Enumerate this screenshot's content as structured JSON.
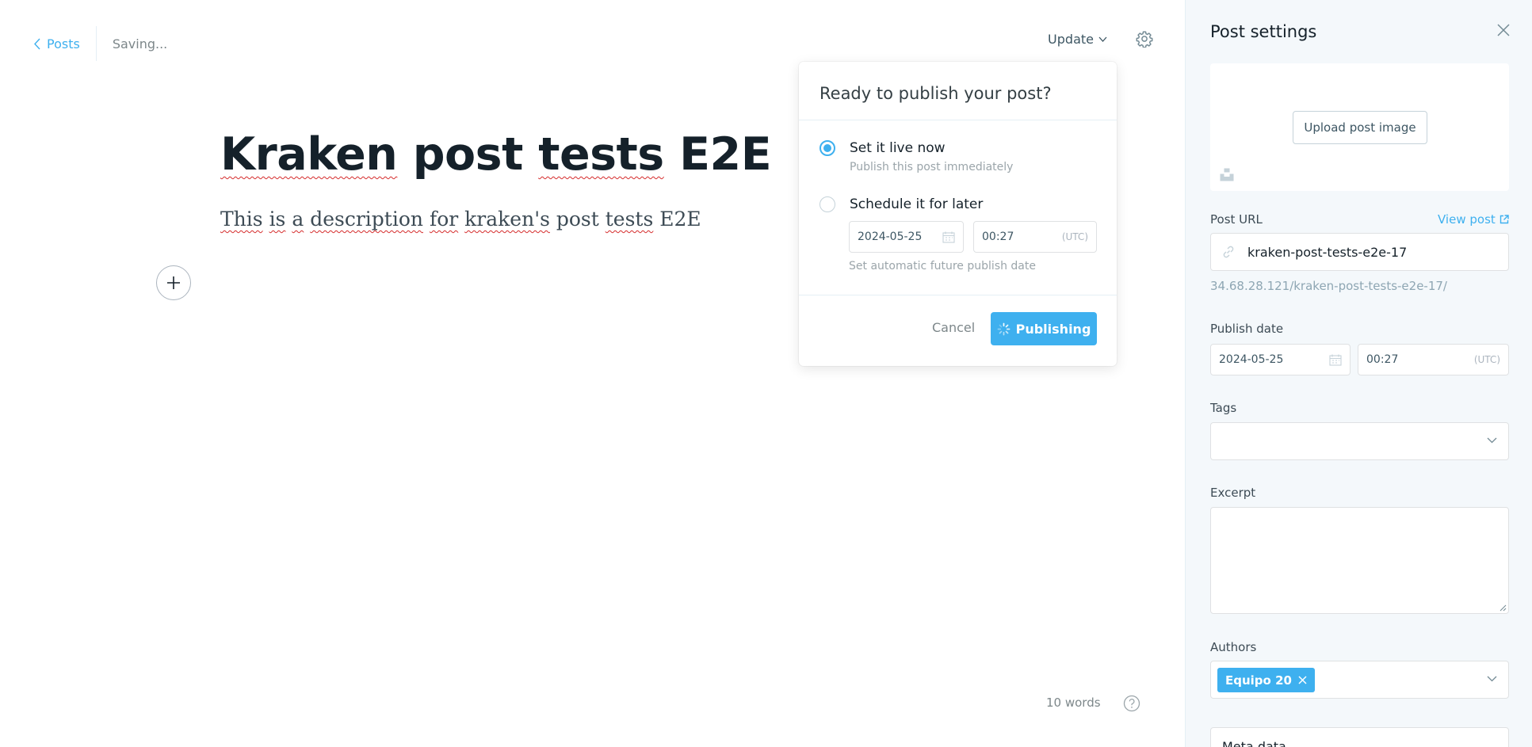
{
  "header": {
    "back_label": "Posts",
    "status": "Saving...",
    "update_label": "Update"
  },
  "post": {
    "title_words": [
      "Kraken",
      "post",
      "tests",
      "E2E"
    ],
    "description_words": [
      "This",
      "is",
      "a",
      "description",
      "for",
      "kraken's",
      "post",
      "tests",
      "E2E"
    ]
  },
  "footer": {
    "word_count": "10 words"
  },
  "publish_popover": {
    "title": "Ready to publish your post?",
    "option_now_title": "Set it live now",
    "option_now_sub": "Publish this post immediately",
    "option_later_title": "Schedule it for later",
    "date": "2024-05-25",
    "time": "00:27",
    "timezone": "(UTC)",
    "hint": "Set automatic future publish date",
    "cancel_label": "Cancel",
    "publish_label": "Publishing",
    "selected_option": "now"
  },
  "sidebar": {
    "title": "Post settings",
    "upload_label": "Upload post image",
    "url_label": "Post URL",
    "view_post_label": "View post",
    "slug": "kraken-post-tests-e2e-17",
    "full_url": "34.68.28.121/kraken-post-tests-e2e-17/",
    "publish_date_label": "Publish date",
    "date": "2024-05-25",
    "time": "00:27",
    "timezone": "(UTC)",
    "tags_label": "Tags",
    "excerpt_label": "Excerpt",
    "authors_label": "Authors",
    "author_chip": "Equipo 20",
    "meta_label": "Meta data"
  },
  "colors": {
    "accent": "#3eb0ef",
    "text": "#15212a",
    "muted": "#7d878a",
    "sidebar_bg": "#f4f8fb"
  }
}
